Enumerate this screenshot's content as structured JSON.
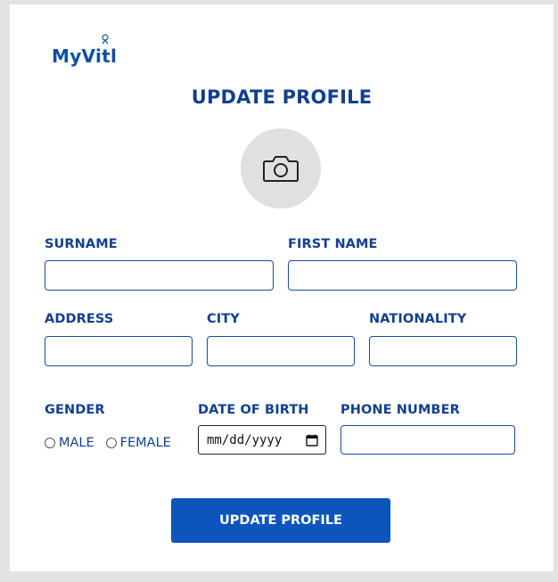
{
  "brand": {
    "name": "MyVitl"
  },
  "page": {
    "title": "UPDATE PROFILE"
  },
  "avatar": {
    "icon": "camera-icon"
  },
  "fields": {
    "surname": {
      "label": "SURNAME",
      "value": ""
    },
    "first_name": {
      "label": "FIRST NAME",
      "value": ""
    },
    "address": {
      "label": "ADDRESS",
      "value": ""
    },
    "city": {
      "label": "CITY",
      "value": ""
    },
    "nationality": {
      "label": "NATIONALITY",
      "value": ""
    },
    "gender": {
      "label": "GENDER",
      "options": [
        "MALE",
        "FEMALE"
      ],
      "selected": ""
    },
    "date_of_birth": {
      "label": "DATE OF BIRTH",
      "placeholder": "mm/dd/yyyy"
    },
    "phone_number": {
      "label": "PHONE NUMBER",
      "value": ""
    }
  },
  "submit": {
    "label": "UPDATE PROFILE"
  },
  "colors": {
    "primary": "#0d54bd",
    "label": "#123f8f",
    "border": "#1a4b9e",
    "background": "#e3e3e3",
    "avatar_bg": "#e0e0e0"
  }
}
